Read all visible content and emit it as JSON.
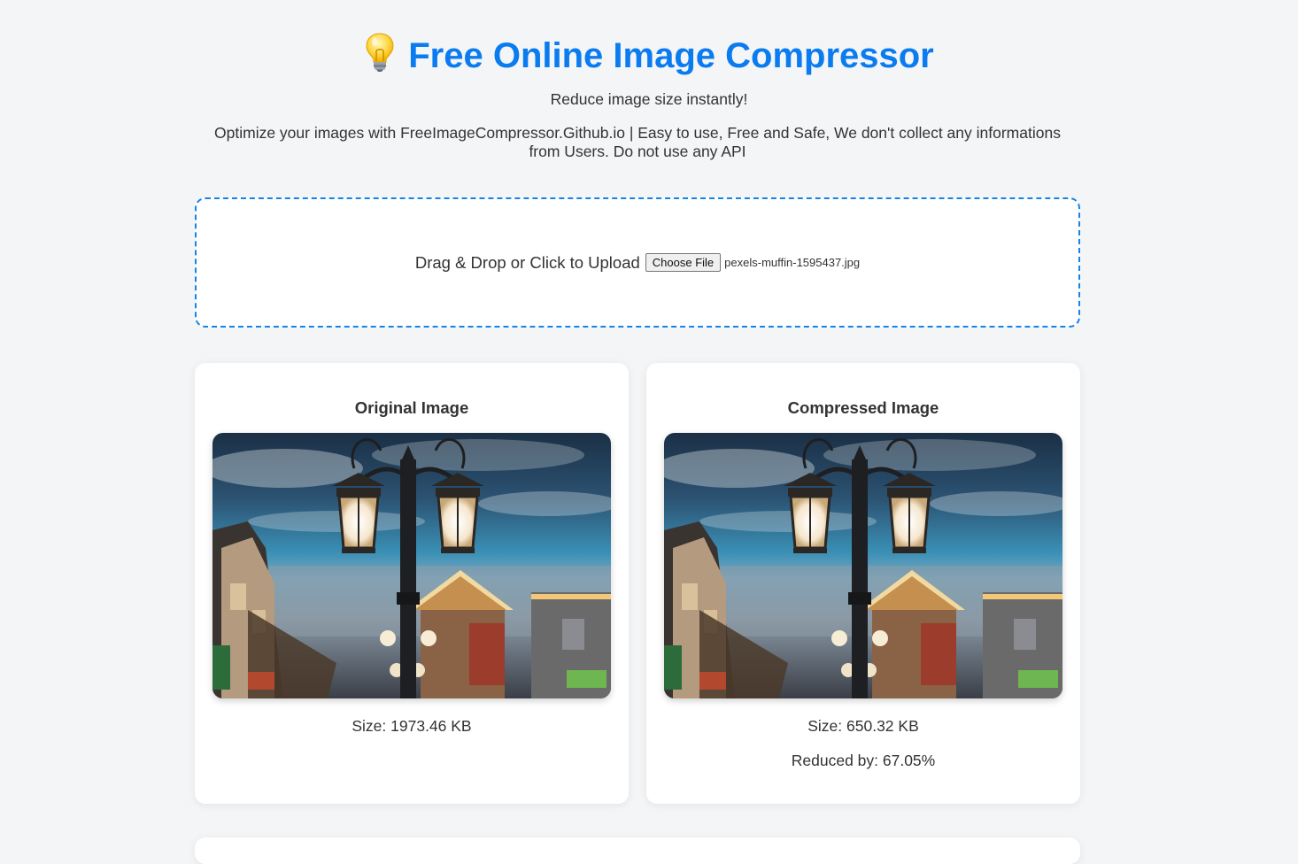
{
  "header": {
    "title": "Free Online Image Compressor",
    "title_icon": "lightbulb-icon",
    "subtitle": "Reduce image size instantly!",
    "description": "Optimize your images with FreeImageCompressor.Github.io | Easy to use, Free and Safe, We don't collect any informations from Users. Do not use any API"
  },
  "upload": {
    "label": "Drag & Drop or Click to Upload",
    "button_label": "Choose File",
    "file_name": "pexels-muffin-1595437.jpg"
  },
  "original": {
    "title": "Original Image",
    "size_text": "Size: 1973.46 KB"
  },
  "compressed": {
    "title": "Compressed Image",
    "size_text": "Size: 650.32 KB",
    "reduced_text": "Reduced by: 67.05%"
  },
  "colors": {
    "accent": "#0a7cf0",
    "upload_border": "#1583e8",
    "background": "#f4f5f7",
    "card": "#ffffff"
  }
}
